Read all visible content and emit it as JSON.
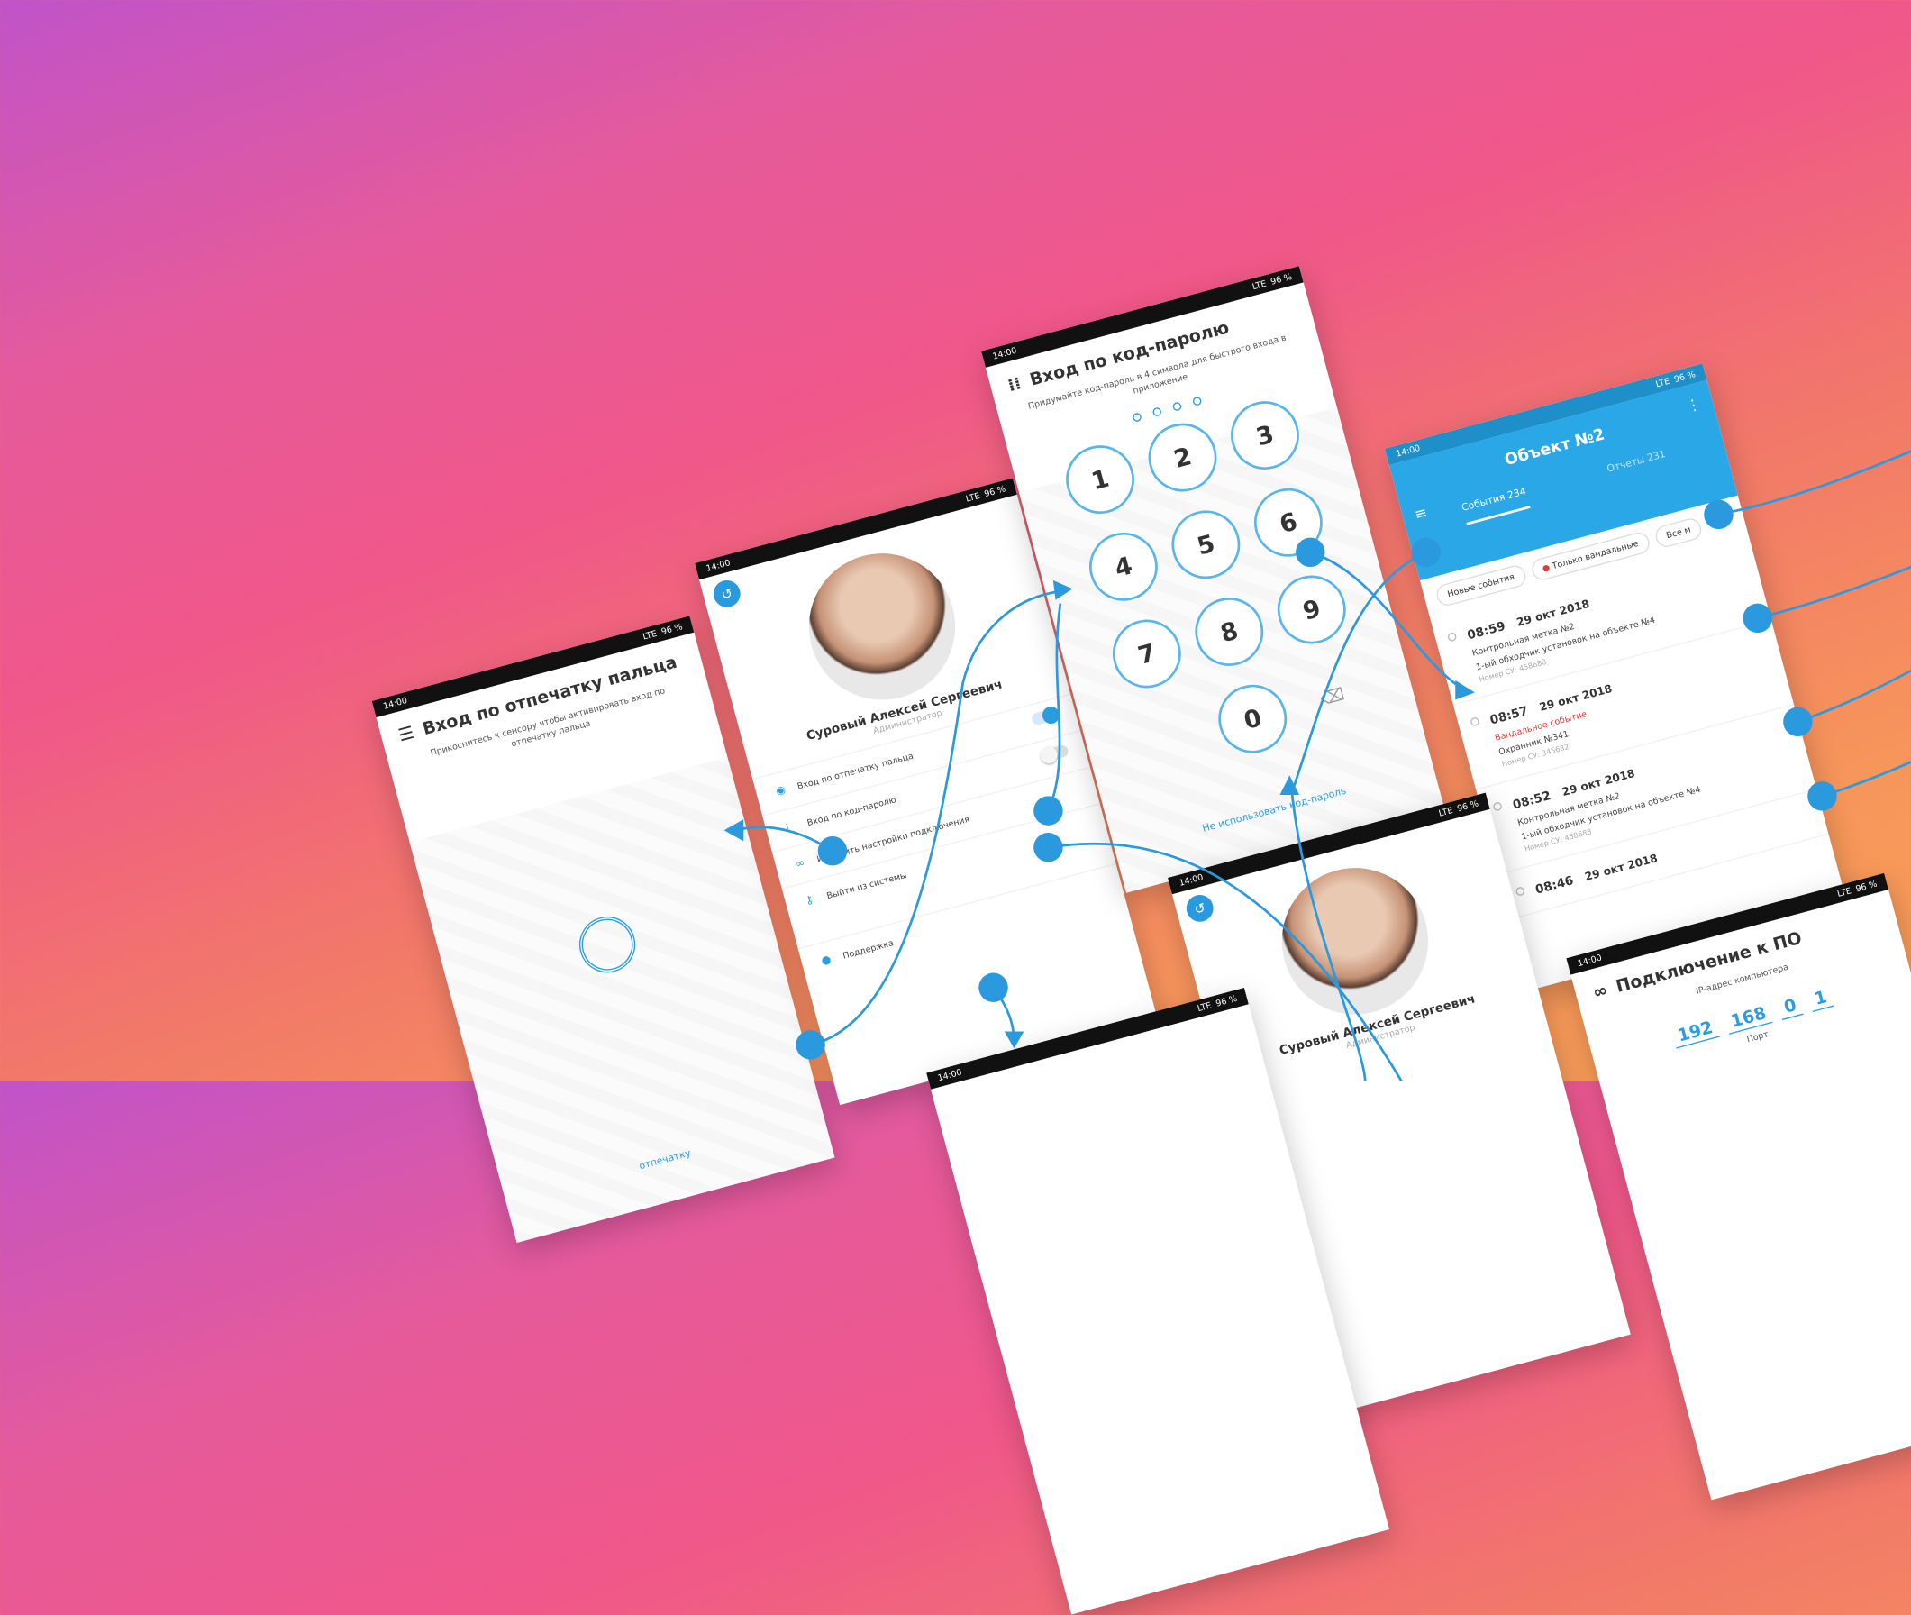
{
  "status": {
    "time": "14:00",
    "network": "LTE",
    "battery": "96 %"
  },
  "fingerprint": {
    "title": "Вход по отпечатку пальца",
    "desc": "Прикоснитесь к сенсору чтобы активировать вход по отпечатку пальца",
    "bottom_link": "отпечатку"
  },
  "profile": {
    "name": "Суровый Алексей Сергеевич",
    "role": "Администратор",
    "menu": [
      {
        "label": "Вход по отпечатку пальца"
      },
      {
        "label": "Вход по код-паролю"
      },
      {
        "label": "Изменить настройки подключения"
      },
      {
        "label": "Выйти из системы"
      },
      {
        "label": "Поддержка"
      }
    ]
  },
  "pin": {
    "title": "Вход по код-паролю",
    "desc": "Придумайте код-пароль в 4 символа для быстрого входа в приложение",
    "keys": [
      "1",
      "2",
      "3",
      "4",
      "5",
      "6",
      "7",
      "8",
      "9",
      "0"
    ],
    "link": "Не использовать код-пароль"
  },
  "events": {
    "title": "Объект №2",
    "tab_events": "События 234",
    "tab_reports": "Отчеты 231",
    "chips": [
      "Новые события",
      "Только вандальные",
      "Все м"
    ],
    "items": [
      {
        "time": "08:59",
        "date": "29 окт 2018",
        "line1": "Контрольная метка №2",
        "line2": "1-ый обходчик установок на объекте №4",
        "num": "Номер СУ: 458688",
        "red": false
      },
      {
        "time": "08:57",
        "date": "29 окт 2018",
        "line1": "Вандальное событие",
        "line2": "Охранник №341",
        "num": "Номер СУ: 345632",
        "red": true
      },
      {
        "time": "08:52",
        "date": "29 окт 2018",
        "line1": "Контрольная метка №2",
        "line2": "1-ый обходчик установок на объекте №4",
        "num": "Номер СУ: 458688",
        "red": false
      },
      {
        "time": "08:46",
        "date": "29 окт 2018",
        "line1": "",
        "line2": "",
        "num": "",
        "red": false
      }
    ]
  },
  "connection": {
    "title": "Подключение к ПО",
    "ip_label": "IP-адрес компьютера",
    "ip": [
      "192",
      "168",
      "0",
      "1"
    ],
    "port_label": "Порт"
  },
  "profile2": {
    "name": "Суровый Алексей Сергеевич",
    "role": "Администратор"
  },
  "accent_color": "#2a9de0"
}
